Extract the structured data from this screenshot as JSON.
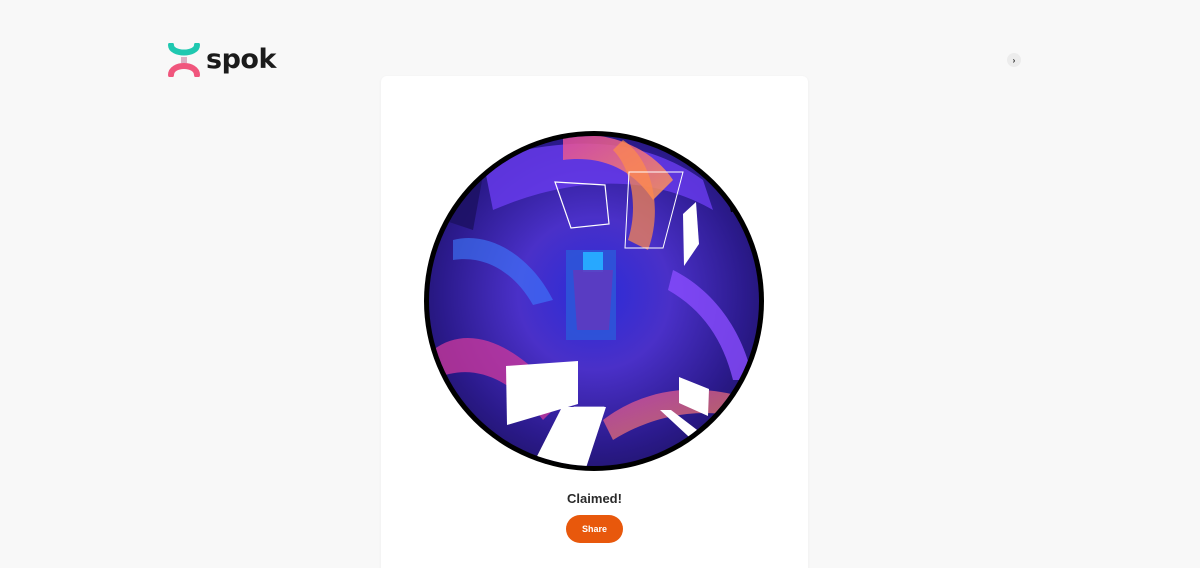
{
  "brand": {
    "name": "spok",
    "logo_icon": "spok-logo-icon",
    "colors": {
      "teal": "#1fc8b0",
      "pink": "#f0567d",
      "text": "#1b1b1b"
    }
  },
  "header": {
    "account_toggle_icon": "chevron-right-icon",
    "account_toggle_glyph": "›"
  },
  "nft": {
    "artwork": "abstract-purple-tunnel-artwork",
    "status": "Claimed!",
    "share_label": "Share",
    "accent_color": "#e8580c"
  }
}
